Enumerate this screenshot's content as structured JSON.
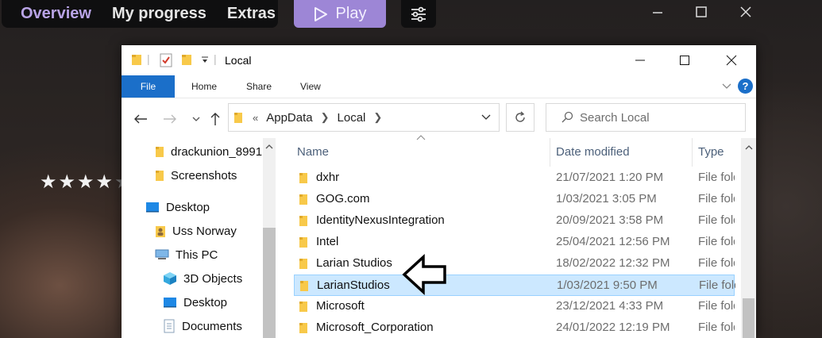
{
  "launcher": {
    "nav": [
      "Overview",
      "My progress",
      "Extras"
    ],
    "play_label": "Play",
    "rating_stars": 4,
    "rating_max": 5
  },
  "explorer": {
    "title": "Local",
    "ribbon_tabs": [
      "File",
      "Home",
      "Share",
      "View"
    ],
    "help_label": "?",
    "breadcrumb": [
      "AppData",
      "Local"
    ],
    "breadcrumb_prefix": "«",
    "search_placeholder": "Search Local",
    "nav_pane": [
      {
        "label": "drackunion_8991",
        "icon": "folder-icon"
      },
      {
        "label": "Screenshots",
        "icon": "folder-icon"
      },
      {
        "label": "Desktop",
        "icon": "desktop-icon"
      },
      {
        "label": "Uss Norway",
        "icon": "user-folder-icon"
      },
      {
        "label": "This PC",
        "icon": "this-pc-icon"
      },
      {
        "label": "3D Objects",
        "icon": "3d-objects-icon"
      },
      {
        "label": "Desktop",
        "icon": "desktop-icon"
      },
      {
        "label": "Documents",
        "icon": "documents-icon"
      }
    ],
    "columns": {
      "name": "Name",
      "date": "Date modified",
      "type": "Type"
    },
    "files": [
      {
        "name": "dxhr",
        "date": "21/07/2021 1:20 PM",
        "type": "File folder"
      },
      {
        "name": "GOG.com",
        "date": "1/03/2021 3:05 PM",
        "type": "File folder"
      },
      {
        "name": "IdentityNexusIntegration",
        "date": "20/09/2021 3:58 PM",
        "type": "File folder"
      },
      {
        "name": "Intel",
        "date": "25/04/2021 12:56 PM",
        "type": "File folder"
      },
      {
        "name": "Larian Studios",
        "date": "18/02/2022 12:32 PM",
        "type": "File folder"
      },
      {
        "name": "LarianStudios",
        "date": "1/03/2021 9:50 PM",
        "type": "File folder",
        "selected": true
      },
      {
        "name": "Microsoft",
        "date": "23/12/2021 4:33 PM",
        "type": "File folder"
      },
      {
        "name": "Microsoft_Corporation",
        "date": "24/01/2022 12:19 PM",
        "type": "File folder"
      }
    ]
  },
  "colors": {
    "accent_purple": "#9d86d6",
    "active_nav": "#b9a4e6",
    "ribbon_file_blue": "#1b6fc9",
    "selection_bg": "#cce8ff",
    "folder_yellow": "#f8c94a"
  }
}
